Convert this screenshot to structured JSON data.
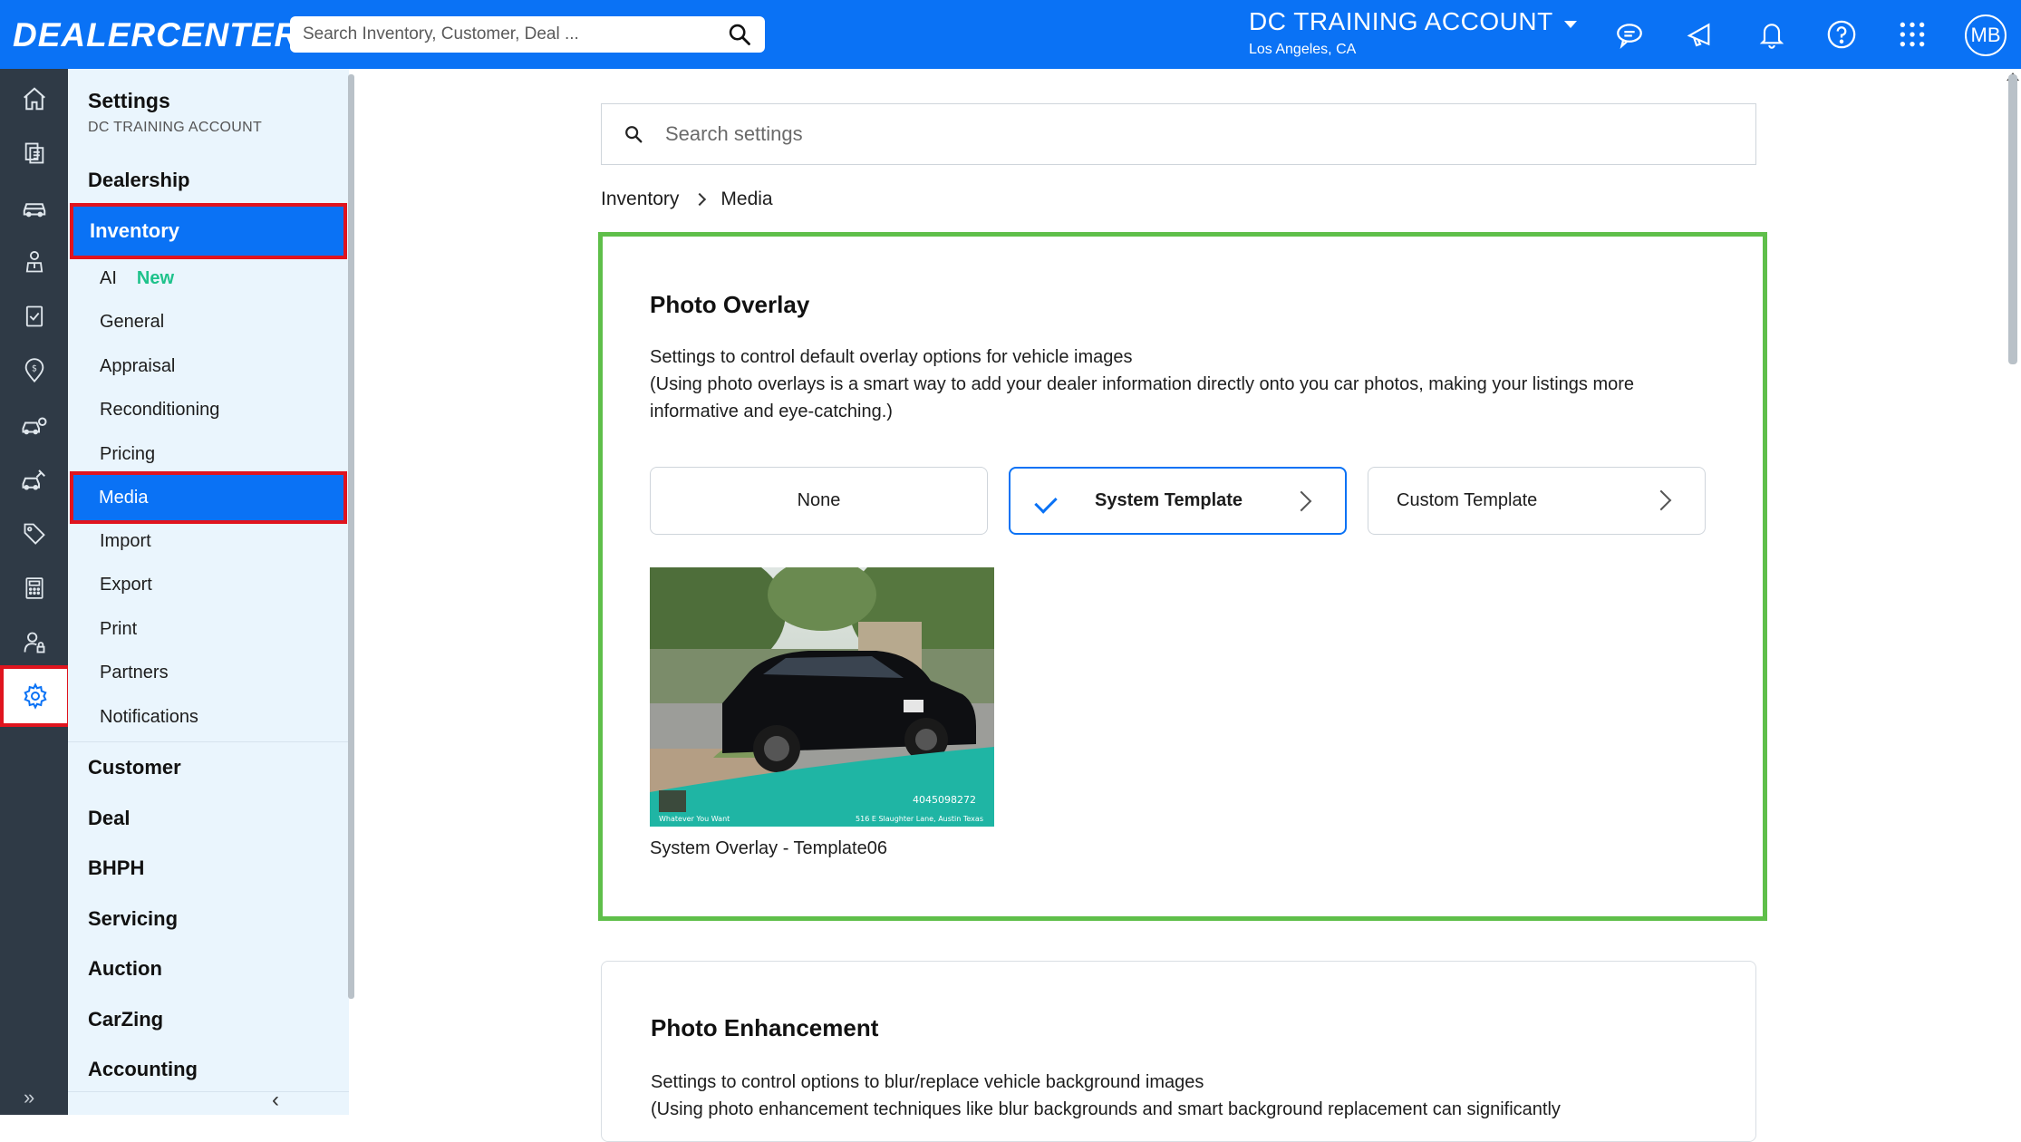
{
  "app": {
    "logo": "DEALERCENTER",
    "search_placeholder": "Search Inventory, Customer, Deal ...",
    "account_name": "DC TRAINING ACCOUNT",
    "account_location": "Los Angeles, CA",
    "avatar_initials": "MB"
  },
  "colors": {
    "brand": "#0a72f5",
    "rail": "#2f3a46",
    "sidebar": "#eaf5fd",
    "highlight_red": "#e0141e",
    "highlight_green": "#5fbf4a",
    "new_badge": "#1ec28b"
  },
  "sidebar": {
    "title": "Settings",
    "subtitle": "DC TRAINING ACCOUNT",
    "sections": [
      "Dealership",
      "Inventory",
      "Customer",
      "Deal",
      "BHPH",
      "Servicing",
      "Auction",
      "CarZing",
      "Accounting"
    ],
    "inventory_items": [
      "AI",
      "General",
      "Appraisal",
      "Reconditioning",
      "Pricing",
      "Media",
      "Import",
      "Export",
      "Print",
      "Partners",
      "Notifications"
    ],
    "new_badge": "New"
  },
  "main": {
    "search_placeholder": "Search settings",
    "breadcrumb": [
      "Inventory",
      "Media"
    ],
    "photo_overlay": {
      "title": "Photo Overlay",
      "desc_line1": "Settings to control default overlay options for vehicle images",
      "desc_line2": "(Using photo overlays is a smart way to add your dealer information directly onto you car photos, making your listings more informative and eye-catching.)",
      "options": [
        "None",
        "System Template",
        "Custom Template"
      ],
      "selected": "System Template",
      "preview_phone": "4045098272",
      "preview_tagline": "Whatever You Want",
      "preview_address": "516 E Slaughter Lane, Austin Texas",
      "preview_caption": "System Overlay - Template06"
    },
    "photo_enhancement": {
      "title": "Photo Enhancement",
      "desc_line1": "Settings to control options to blur/replace vehicle background images",
      "desc_line2": "(Using photo enhancement techniques like blur backgrounds and smart background replacement can significantly"
    }
  }
}
